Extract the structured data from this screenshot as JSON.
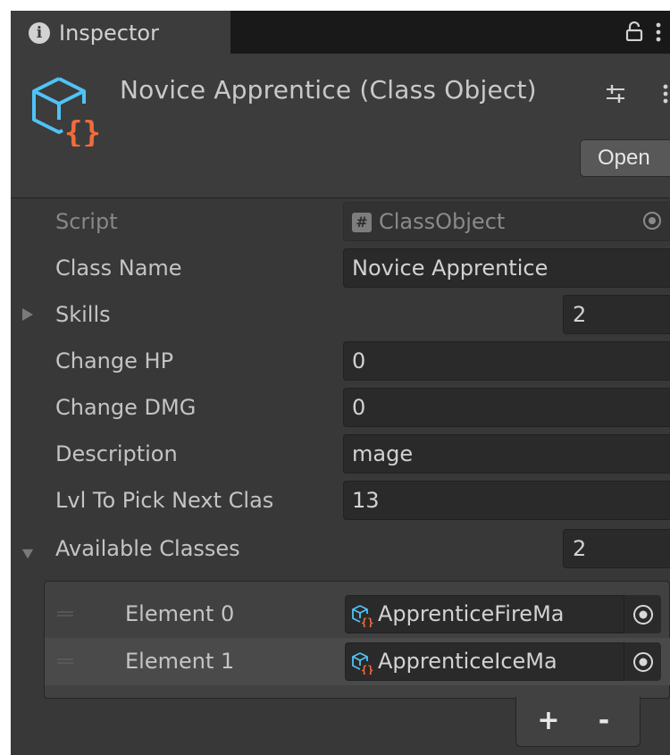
{
  "tab": {
    "title": "Inspector",
    "icon": "info-icon"
  },
  "header": {
    "title": "Novice Apprentice (Class Object)",
    "open_label": "Open",
    "icon": "scriptable-object-icon"
  },
  "properties": {
    "script": {
      "label": "Script",
      "value": "ClassObject"
    },
    "class_name": {
      "label": "Class Name",
      "value": "Novice Apprentice"
    },
    "skills": {
      "label": "Skills",
      "count": "2"
    },
    "change_hp": {
      "label": "Change HP",
      "value": "0"
    },
    "change_dmg": {
      "label": "Change DMG",
      "value": "0"
    },
    "description": {
      "label": "Description",
      "value": "mage"
    },
    "lvl_to_pick": {
      "label": "Lvl To Pick Next Clas",
      "value": "13"
    },
    "available_classes": {
      "label": "Available Classes",
      "count": "2"
    }
  },
  "list": {
    "elements": [
      {
        "label": "Element 0",
        "value": "ApprenticeFireMa"
      },
      {
        "label": "Element 1",
        "value": "ApprenticeIceMa"
      }
    ],
    "add_label": "+",
    "remove_label": "-"
  },
  "colors": {
    "background": "#383838",
    "field": "#2a2a2a",
    "icon_blue": "#4fc3f7",
    "icon_orange": "#f26b3a"
  }
}
